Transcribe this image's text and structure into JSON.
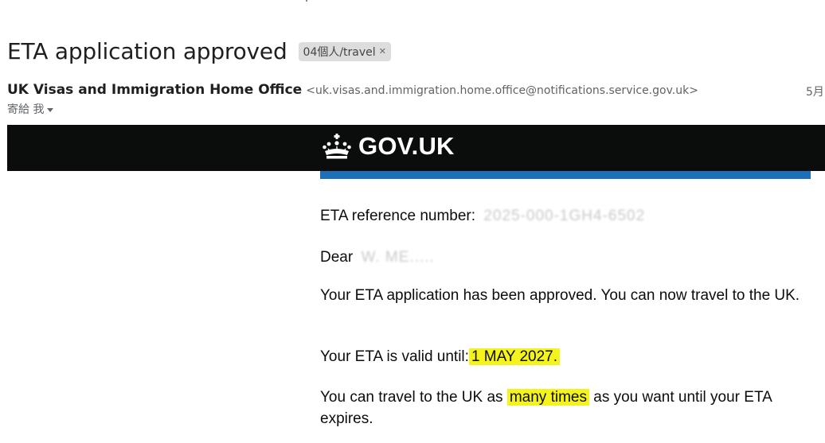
{
  "email": {
    "subject": "ETA application approved",
    "label": "04個人/travel",
    "sender_name": "UK Visas and Immigration Home Office",
    "sender_email": "<uk.visas.and.immigration.home.office@notifications.service.gov.uk>",
    "date": "5月",
    "to_text": "寄給 我"
  },
  "gov": {
    "logo_text": "GOV.UK",
    "crown_icon": "crown-icon",
    "header_bg": "#0b0c0c",
    "stripe_color": "#1d70b8"
  },
  "body": {
    "ref_label": "ETA reference number:",
    "ref_value": "2025-000-1GH4-6502",
    "dear": "Dear",
    "dear_name": "W. ME.....",
    "approved_text": "Your ETA application has been approved. You can now travel to the UK.",
    "valid_label": "Your ETA is valid until:",
    "valid_date": "1 MAY 2027.",
    "times_pre": "You can travel to the UK as",
    "times_hl": "many times",
    "times_post": "as you want until your ETA expires.",
    "highlight_color": "#f4f41c"
  }
}
